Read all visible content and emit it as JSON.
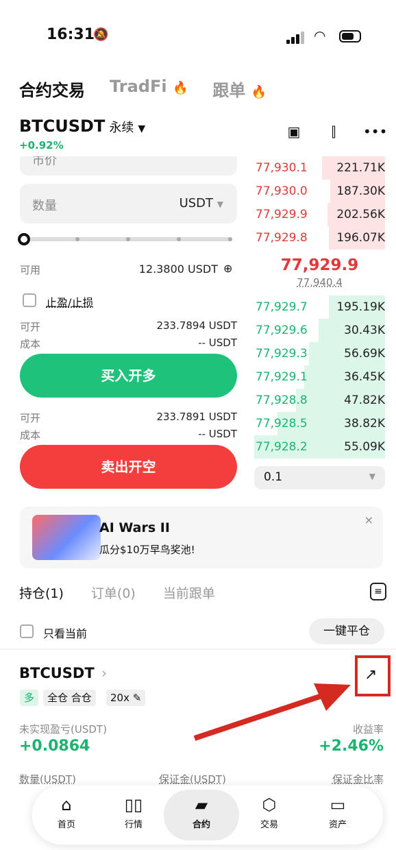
{
  "status": {
    "time": "16:31"
  },
  "top_tabs": [
    {
      "label": "合约交易",
      "active": true
    },
    {
      "label": "TradFi",
      "active": false,
      "hot": true
    },
    {
      "label": "跟单",
      "active": false,
      "hot": true
    }
  ],
  "pair": {
    "symbol": "BTCUSDT",
    "type": "永续",
    "change": "+0.92%"
  },
  "order_form": {
    "price_placeholder": "市价",
    "quantity_label": "数量",
    "quantity_unit": "USDT",
    "slider_fraction": 0,
    "available_label": "可用",
    "available_value": "12.3800 USDT",
    "tpsl_label": "止盈/止损",
    "buy": {
      "can_open_label": "可开",
      "can_open_value": "233.7894 USDT",
      "cost_label": "成本",
      "cost_value": "-- USDT",
      "button": "买入开多"
    },
    "sell": {
      "can_open_label": "可开",
      "can_open_value": "233.7891 USDT",
      "cost_label": "成本",
      "cost_value": "-- USDT",
      "button": "卖出开空"
    }
  },
  "orderbook": {
    "asks": [
      {
        "price": "77,930.1",
        "qty": "221.71K",
        "depth": 0.48
      },
      {
        "price": "77,930.0",
        "qty": "187.30K",
        "depth": 0.42
      },
      {
        "price": "77,929.9",
        "qty": "202.56K",
        "depth": 0.44
      },
      {
        "price": "77,929.8",
        "qty": "196.07K",
        "depth": 0.43
      }
    ],
    "last_price": "77,929.9",
    "mark_price": "77,940.4",
    "bids": [
      {
        "price": "77,929.7",
        "qty": "195.19K",
        "depth": 0.43
      },
      {
        "price": "77,929.6",
        "qty": "30.43K",
        "depth": 0.51
      },
      {
        "price": "77,929.3",
        "qty": "56.69K",
        "depth": 0.58
      },
      {
        "price": "77,929.1",
        "qty": "36.45K",
        "depth": 0.62
      },
      {
        "price": "77,928.8",
        "qty": "47.82K",
        "depth": 0.68
      },
      {
        "price": "77,928.5",
        "qty": "38.82K",
        "depth": 0.82
      },
      {
        "price": "77,928.2",
        "qty": "55.09K",
        "depth": 1.0
      }
    ],
    "precision": "0.1"
  },
  "banner": {
    "title": "AI Wars II",
    "subtitle": "瓜分$10万早鸟奖池!",
    "close": "×"
  },
  "position_tabs": [
    {
      "label": "持仓(1)",
      "active": true
    },
    {
      "label": "订单(0)",
      "active": false
    },
    {
      "label": "当前跟单",
      "active": false
    }
  ],
  "only_current_label": "只看当前",
  "close_all_label": "一键平仓",
  "position": {
    "symbol": "BTCUSDT",
    "side": "多",
    "margin_mode": "全仓 合仓",
    "leverage": "20x",
    "pnl_label": "未实现盈亏(USDT)",
    "pnl_value": "+0.0864",
    "roi_label": "收益率",
    "roi_value": "+2.46%",
    "qty_label": "数量(USDT)",
    "margin_label": "保证金(USDT)",
    "margin_ratio_label": "保证金比率"
  },
  "bottom_nav": [
    {
      "label": "首页",
      "icon": "home-icon"
    },
    {
      "label": "行情",
      "icon": "market-icon"
    },
    {
      "label": "合约",
      "icon": "futures-icon",
      "active": true
    },
    {
      "label": "交易",
      "icon": "trade-icon"
    },
    {
      "label": "资产",
      "icon": "wallet-icon"
    }
  ],
  "colors": {
    "buy": "#1ec27a",
    "sell": "#f43d3d",
    "annotation": "#d42a1f"
  }
}
